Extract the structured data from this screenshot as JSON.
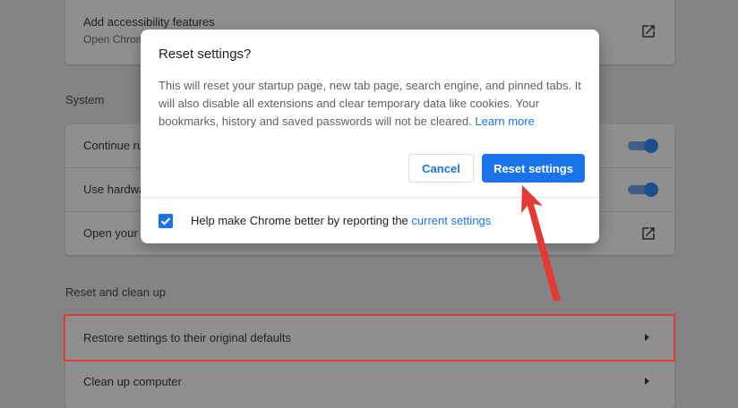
{
  "background": {
    "accessibility_card": {
      "title": "Add accessibility features",
      "subtitle": "Open Chrome"
    },
    "system": {
      "section_title": "System",
      "rows": [
        {
          "label": "Continue ru",
          "control": "toggle"
        },
        {
          "label": "Use hardwa",
          "control": "toggle"
        },
        {
          "label": "Open your c",
          "control": "external-link"
        }
      ]
    },
    "reset": {
      "section_title": "Reset and clean up",
      "rows": [
        {
          "label": "Restore settings to their original defaults"
        },
        {
          "label": "Clean up computer"
        }
      ]
    }
  },
  "dialog": {
    "title": "Reset settings?",
    "body": "This will reset your startup page, new tab page, search engine, and pinned tabs. It will also disable all extensions and clear temporary data like cookies. Your bookmarks, history and saved passwords will not be cleared.",
    "learn_more": "Learn more",
    "cancel_label": "Cancel",
    "reset_label": "Reset settings",
    "footer_text": "Help make Chrome better by reporting the ",
    "footer_link": "current settings",
    "checkbox_checked": true
  },
  "colors": {
    "accent": "#1a73e8",
    "annotation": "#e53935"
  }
}
